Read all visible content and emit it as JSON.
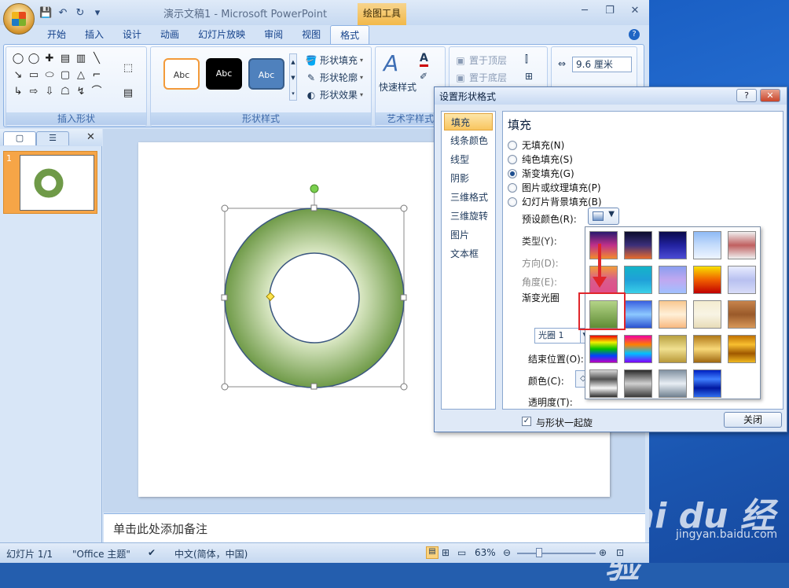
{
  "window": {
    "title": "演示文稿1 - Microsoft PowerPoint",
    "tool_tab_title": "绘图工具",
    "controls": {
      "minimize": "─",
      "restore": "❐",
      "close": "✕"
    }
  },
  "ribbon": {
    "tabs": [
      "开始",
      "插入",
      "设计",
      "动画",
      "幻灯片放映",
      "审阅",
      "视图",
      "格式"
    ],
    "active_tab": "格式",
    "groups": {
      "insert_shapes": "插入形状",
      "shape_styles": "形状样式",
      "wordart_styles": "艺术字样式"
    },
    "style_thumbs": [
      "Abc",
      "Abc",
      "Abc"
    ],
    "cmds": {
      "shape_fill": "形状填充",
      "shape_outline": "形状轮廓",
      "shape_effects": "形状效果",
      "quick_styles": "快速样式",
      "bring_front": "置于顶层",
      "send_back": "置于底层",
      "width_value": "9.6 厘米"
    }
  },
  "left_pane": {
    "slide_number": "1"
  },
  "notes": {
    "placeholder": "单击此处添加备注"
  },
  "statusbar": {
    "slide": "幻灯片 1/1",
    "theme": "\"Office 主题\"",
    "language": "中文(简体，中国)",
    "zoom": "63%"
  },
  "dialog": {
    "title": "设置形状格式",
    "help": "?",
    "close_x": "✕",
    "nav": [
      "填充",
      "线条颜色",
      "线型",
      "阴影",
      "三维格式",
      "三维旋转",
      "图片",
      "文本框"
    ],
    "nav_selected": "填充",
    "panel_title": "填充",
    "options": [
      {
        "label": "无填充(N)",
        "selected": false
      },
      {
        "label": "纯色填充(S)",
        "selected": false
      },
      {
        "label": "渐变填充(G)",
        "selected": true
      },
      {
        "label": "图片或纹理填充(P)",
        "selected": false
      },
      {
        "label": "幻灯片背景填充(B)",
        "selected": false
      }
    ],
    "preset_label": "预设颜色(R):",
    "type_label": "类型(Y):",
    "direction_label": "方向(D):",
    "angle_label": "角度(E):",
    "stops_label": "渐变光圈",
    "stop_value": "光圈 1",
    "end_position_label": "结束位置(O):",
    "color_label": "颜色(C):",
    "transparency_label": "透明度(T):",
    "rotate_label": "与形状一起旋",
    "close_button": "关闭"
  },
  "gallery_colors": [
    [
      "#2a1a6e|#c0308a|#f28a2d",
      "#0c0c2c|#3b2f7a|#e86b2c",
      "#0a0a4a|#2222a0|#4c4cd4",
      "#8fbaf5|#c5dcfb|#eef5ff",
      "#f0f0f0|#c06060|#f0f0f0"
    ],
    [
      "#f29c3a|#d85c8c|#e04e8a",
      "#14b4c8|#1fa0d8|#3ad0e8",
      "#8a9ef0|#c0a8f0|#a0c0ff",
      "#f8e000|#f06000|#c00000",
      "#e8ecff|#b8c0f0|#d8dcf8"
    ],
    [
      "#b4d487|#5f8c35",
      "#3a60e0|#8cc8ff|#2a50d0",
      "#f8c890|#fff0d8|#f8b880",
      "#f4ecd0|#f8f4e4|#e8dcb8",
      "#c8844c|#9a5a2a|#d89858"
    ],
    [
      "#f00000|#f0f000|#00c000|#0040ff|#c000c0",
      "#f000a0|#ff8000|#00c0ff|#8000ff",
      "#b8a040|#f0e090|#b89838",
      "#b07818|#f8d878|#a06810",
      "#c07000|#f8c030|#a05800|#f0b820"
    ],
    [
      "#d8d8d8|#505050|#f8f8f8|#303030",
      "#2a2a2a|#d0d0d0|#3a3a3a",
      "#8090a0|#e8eef4|#708090",
      "#0020c0|#4080ff|#0018a0|#3070f0",
      ""
    ]
  ],
  "watermark": {
    "brand": "Bai du 经验",
    "url": "jingyan.baidu.com"
  }
}
